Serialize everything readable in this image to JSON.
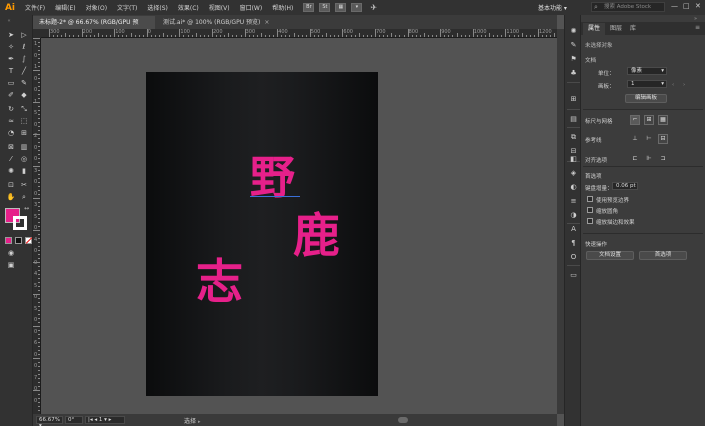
{
  "app": {
    "logo": "Ai",
    "menu": [
      "文件(F)",
      "编辑(E)",
      "对象(O)",
      "文字(T)",
      "选择(S)",
      "效果(C)",
      "视图(V)",
      "窗口(W)",
      "帮助(H)"
    ],
    "mini_buttons": [
      "Br",
      "St"
    ],
    "workspace": "基本功能",
    "search_placeholder": "搜索 Adobe Stock",
    "window_controls": [
      "—",
      "□",
      "✕"
    ]
  },
  "tabs": [
    {
      "label": "未标题-2* @ 66.67% (RGB/GPU 预览)",
      "active": true
    },
    {
      "label": "测试.ai* @ 100% (RGB/GPU 预览)",
      "active": false
    }
  ],
  "ruler": {
    "h_labels": [
      "300",
      "200",
      "100",
      "0",
      "100",
      "200",
      "300",
      "400",
      "500",
      "600",
      "700",
      "800",
      "900",
      "1000",
      "1100",
      "1200"
    ],
    "v_labels": [
      "1",
      "0",
      "1",
      "0",
      "0",
      "1",
      "5",
      "0",
      "2",
      "0",
      "0",
      "3",
      "0",
      "0",
      "3",
      "5",
      "0",
      "4",
      "0",
      "0",
      "4",
      "5",
      "0",
      "5",
      "0",
      "0",
      "6",
      "0",
      "0",
      "7",
      "0",
      "0"
    ]
  },
  "toolbar": {
    "tools": [
      "selection-icon",
      "direct-selection-icon",
      "magic-wand-icon",
      "lasso-icon",
      "pen-icon",
      "curvature-icon",
      "type-icon",
      "line-icon",
      "rectangle-icon",
      "paintbrush-icon",
      "shaper-icon",
      "pencil-icon",
      "rotate-icon",
      "scale-icon",
      "width-icon",
      "free-transform-icon",
      "shape-builder-icon",
      "perspective-icon",
      "mesh-icon",
      "gradient-icon",
      "eyedropper-icon",
      "blend-icon",
      "symbol-sprayer-icon",
      "column-graph-icon",
      "artboard-icon",
      "slice-icon",
      "hand-icon",
      "zoom-icon"
    ],
    "fill_color": "#e6208a",
    "stroke_color": "#ffffff"
  },
  "artboard": {
    "chars": [
      "野",
      "鹿",
      "志"
    ],
    "text_color": "#e6208a"
  },
  "status": {
    "zoom": "66.67%",
    "angle": "0°",
    "artboard_num": "1",
    "tool_label": "选择"
  },
  "panel": {
    "tabs": [
      "属性",
      "图层",
      "库"
    ],
    "section_title": "未选择对象",
    "document_label": "文档",
    "unit_label": "单位：",
    "unit_value": "像素",
    "artboard_label": "画板：",
    "artboard_value": "1",
    "edit_artboard_button": "编辑画板",
    "rulers_grids_label": "标尺与网格",
    "guides_label": "参考线",
    "align_label": "对齐选项",
    "prefs_label": "首选项",
    "keyboard_increment_label": "键盘增量：",
    "keyboard_increment_value": "0.06 pt",
    "checkboxes": [
      "使用预览边界",
      "缩放圆角",
      "缩放描边和效果"
    ],
    "quick_actions_label": "快速操作",
    "doc_settings_button": "文档设置",
    "preferences_button": "首选项"
  }
}
